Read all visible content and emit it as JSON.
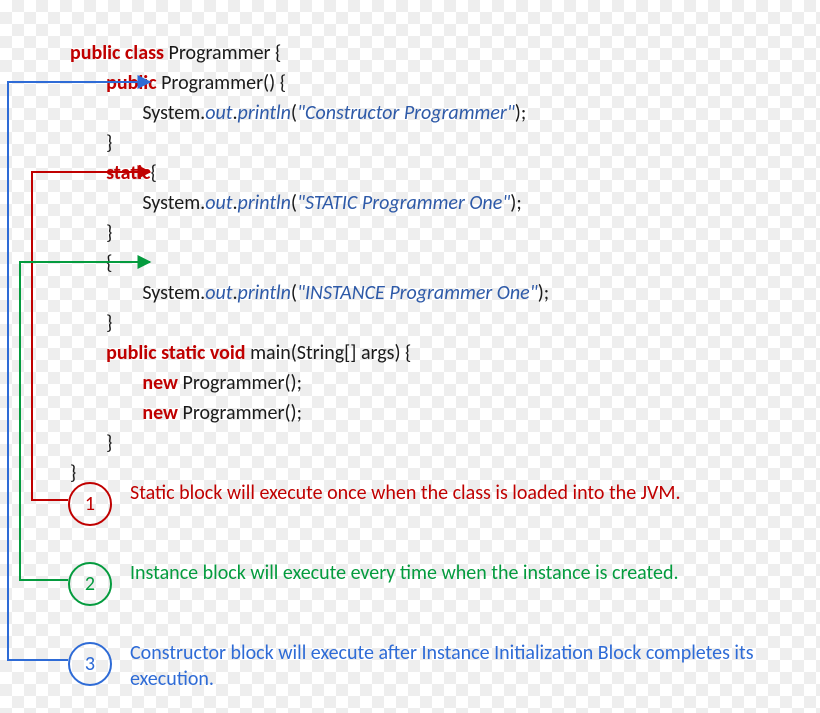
{
  "code": {
    "l1": {
      "kw": "public class ",
      "name": "Programmer {"
    },
    "l2": {
      "kw": "public ",
      "rest": "Programmer() {"
    },
    "l3": {
      "sys": "System.",
      "out": "out",
      "dot": ".",
      "method": "println",
      "open": "(",
      "str": "\"Constructor Programmer\"",
      "close": ");"
    },
    "l4": {
      "brace": "}"
    },
    "l5": {
      "kw": "static",
      "open": "{"
    },
    "l6": {
      "sys": "System.",
      "out": "out",
      "dot": ".",
      "method": "println",
      "open": "(",
      "str": "\"STATIC Programmer One\"",
      "close": ");"
    },
    "l7": {
      "brace": "}"
    },
    "l8": {
      "open": "{"
    },
    "l9": {
      "sys": "System.",
      "out": "out",
      "dot": ".",
      "method": "println",
      "open": "(",
      "str": "\"INSTANCE Programmer One\"",
      "close": ");"
    },
    "l10": {
      "brace": "}"
    },
    "l11": {
      "kw": "public static void ",
      "rest": "main(String[] args) {"
    },
    "l12": {
      "kw": "new ",
      "rest": "Programmer();"
    },
    "l13": {
      "kw": "new ",
      "rest": "Programmer();"
    },
    "l14": {
      "brace": "}"
    },
    "l15": {
      "brace": "}"
    }
  },
  "legend": {
    "n1": "1",
    "t1": "Static block will execute once when the class is loaded into the JVM.",
    "n2": "2",
    "t2": "Instance block will execute every time when the instance is created.",
    "n3": "3",
    "t3": "Constructor block will execute after Instance Initialization Block completes its execution."
  },
  "colors": {
    "red": "#c00000",
    "green": "#049b3e",
    "blue": "#2e6bd6"
  }
}
